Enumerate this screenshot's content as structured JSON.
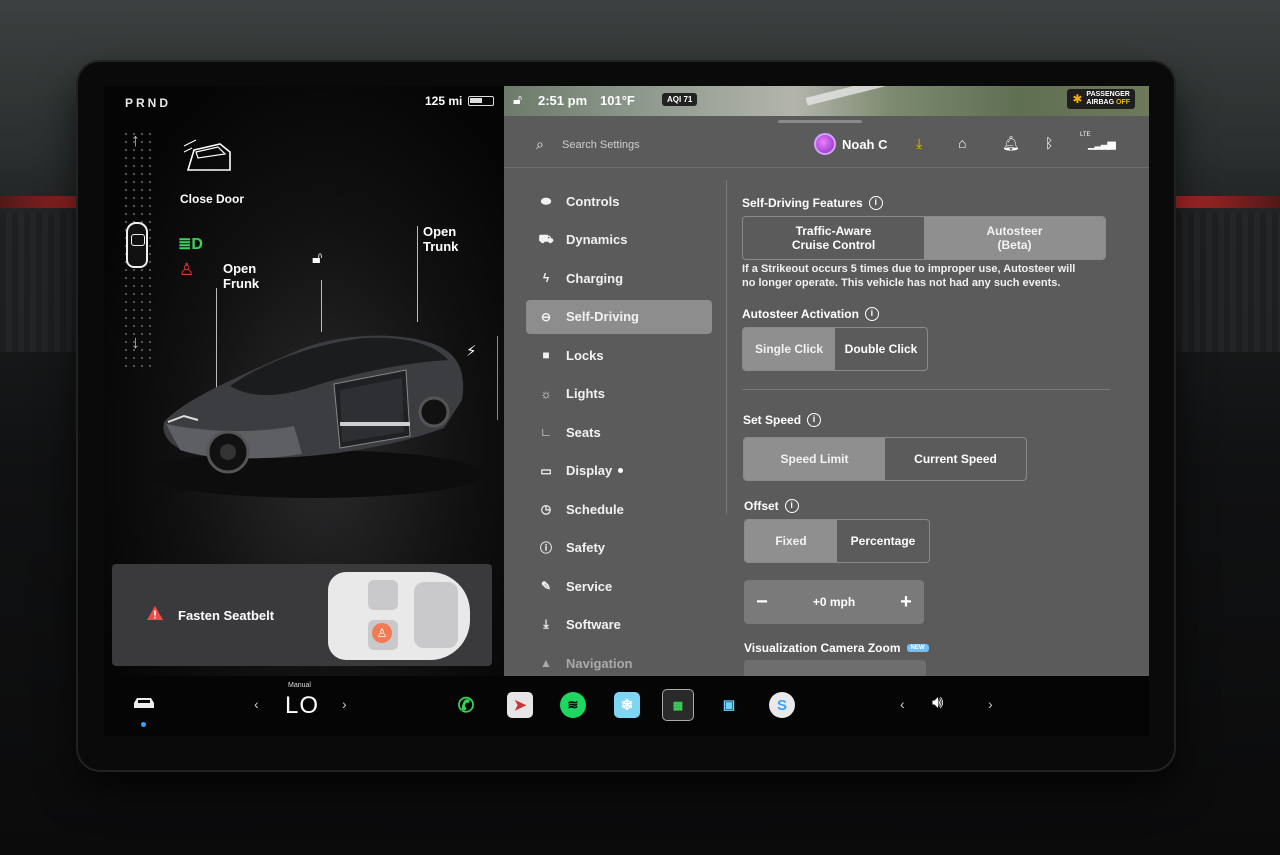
{
  "car_panel": {
    "gear": "PRND",
    "range": "125 mi",
    "close_door": "Close Door",
    "open_frunk_line1": "Open",
    "open_frunk_line2": "Frunk",
    "open_trunk_line1": "Open",
    "open_trunk_line2": "Trunk",
    "alert_text": "Fasten Seatbelt"
  },
  "status_bar": {
    "time": "2:51 pm",
    "temperature": "101°F",
    "aqi": "AQI 71",
    "airbag_line1": "PASSENGER",
    "airbag_line2": "AIRBAG",
    "airbag_state": "OFF"
  },
  "topbar": {
    "search_placeholder": "Search Settings",
    "profile_name": "Noah C",
    "signal": "LTE"
  },
  "menu": {
    "items": [
      {
        "label": "Controls",
        "icon": "toggle-icon"
      },
      {
        "label": "Dynamics",
        "icon": "car-icon"
      },
      {
        "label": "Charging",
        "icon": "bolt-icon"
      },
      {
        "label": "Self-Driving",
        "icon": "steering-wheel-icon"
      },
      {
        "label": "Locks",
        "icon": "lock-icon"
      },
      {
        "label": "Lights",
        "icon": "sun-icon"
      },
      {
        "label": "Seats",
        "icon": "seat-icon"
      },
      {
        "label": "Display",
        "icon": "display-icon"
      },
      {
        "label": "Schedule",
        "icon": "clock-icon"
      },
      {
        "label": "Safety",
        "icon": "safety-icon"
      },
      {
        "label": "Service",
        "icon": "wrench-icon"
      },
      {
        "label": "Software",
        "icon": "download-icon"
      },
      {
        "label": "Navigation",
        "icon": "navigation-icon"
      }
    ],
    "active": "Self-Driving"
  },
  "self_driving": {
    "features_title": "Self-Driving Features",
    "tacc_line1": "Traffic-Aware",
    "tacc_line2": "Cruise Control",
    "autosteer_line1": "Autosteer",
    "autosteer_line2": "(Beta)",
    "features_selected": "Autosteer (Beta)",
    "strikeout_note_line1": "If a Strikeout occurs 5 times due to improper use, Autosteer will",
    "strikeout_note_line2": "no longer operate. This vehicle has not had any such events.",
    "activation_title": "Autosteer Activation",
    "activation_options": [
      "Single Click",
      "Double Click"
    ],
    "activation_selected": "Single Click",
    "set_speed_title": "Set Speed",
    "set_speed_options": [
      "Speed Limit",
      "Current Speed"
    ],
    "set_speed_selected": "Speed Limit",
    "offset_title": "Offset",
    "offset_options": [
      "Fixed",
      "Percentage"
    ],
    "offset_selected": "Fixed",
    "offset_minus": "−",
    "offset_value": "+0 mph",
    "offset_plus": "+",
    "zoom_title": "Visualization Camera Zoom",
    "zoom_badge": "NEW"
  },
  "dock": {
    "climate_label": "Manual",
    "climate_value": "LO",
    "apps": [
      "phone-icon",
      "navigation-app-icon",
      "spotify-icon",
      "toybox-icon",
      "dashcam-icon",
      "theater-icon",
      "app-icon"
    ],
    "volume_icon": "volume-icon"
  },
  "colors": {
    "panel_bg": "#5b5b5c",
    "active_menu": "#8d8d8e",
    "alert_red": "#e53935",
    "headlight_green": "#3ad35a",
    "accent_orange": "#f2b400"
  }
}
